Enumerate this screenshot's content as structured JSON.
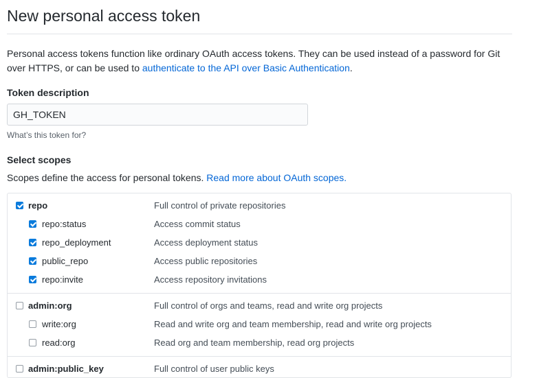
{
  "page": {
    "title": "New personal access token",
    "intro_text": "Personal access tokens function like ordinary OAuth access tokens. They can be used instead of a password for Git over HTTPS, or can be used to ",
    "intro_link": "authenticate to the API over Basic Authentication",
    "intro_end": "."
  },
  "token": {
    "label": "Token description",
    "value": "GH_TOKEN",
    "note": "What’s this token for?"
  },
  "scopes": {
    "label": "Select scopes",
    "desc_text": "Scopes define the access for personal tokens. ",
    "desc_link": "Read more about OAuth scopes.",
    "groups": [
      {
        "name": "repo",
        "desc": "Full control of private repositories",
        "checked": true,
        "children": [
          {
            "name": "repo:status",
            "desc": "Access commit status",
            "checked": true
          },
          {
            "name": "repo_deployment",
            "desc": "Access deployment status",
            "checked": true
          },
          {
            "name": "public_repo",
            "desc": "Access public repositories",
            "checked": true
          },
          {
            "name": "repo:invite",
            "desc": "Access repository invitations",
            "checked": true
          }
        ]
      },
      {
        "name": "admin:org",
        "desc": "Full control of orgs and teams, read and write org projects",
        "checked": false,
        "children": [
          {
            "name": "write:org",
            "desc": "Read and write org and team membership, read and write org projects",
            "checked": false
          },
          {
            "name": "read:org",
            "desc": "Read org and team membership, read org projects",
            "checked": false
          }
        ]
      },
      {
        "name": "admin:public_key",
        "desc": "Full control of user public keys",
        "checked": false,
        "children": []
      }
    ]
  },
  "colors": {
    "link": "#0366d6",
    "checkbox_checked": "#0a7bdc",
    "border": "#e1e4e8"
  }
}
